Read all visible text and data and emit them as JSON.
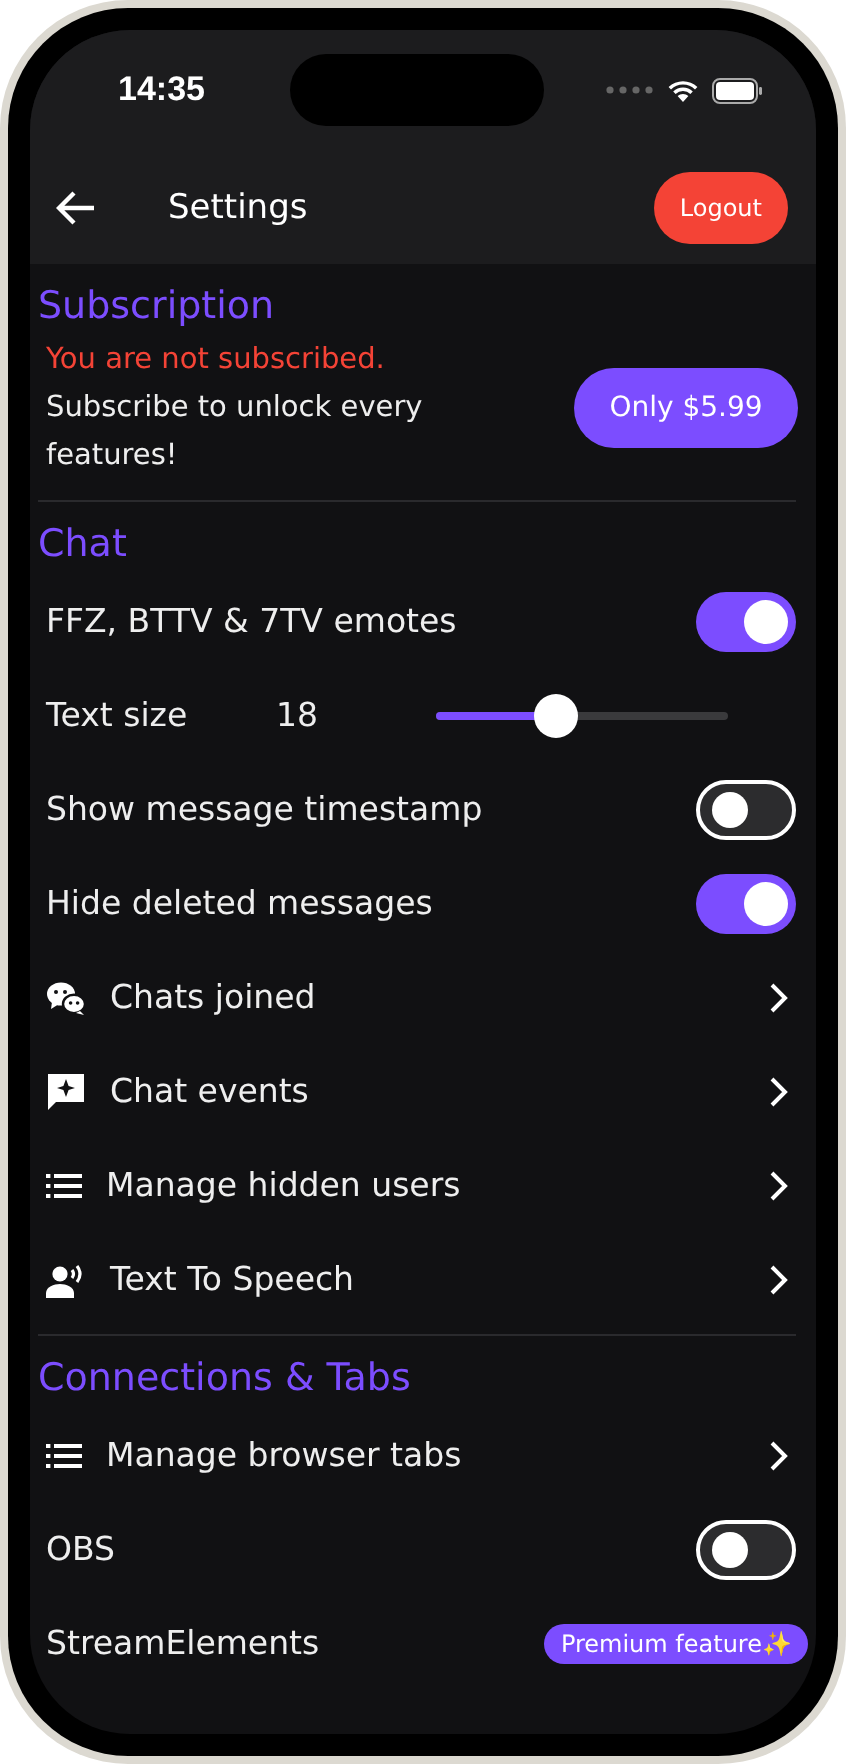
{
  "status_bar": {
    "time": "14:35"
  },
  "app_bar": {
    "title": "Settings",
    "logout": "Logout"
  },
  "sections": [
    {
      "title": "Subscription",
      "warning": "You are not subscribed.",
      "message": "Subscribe to unlock every features!",
      "button": "Only $5.99"
    },
    {
      "title": "Chat",
      "items": [
        {
          "kind": "toggle",
          "label": "FFZ, BTTV & 7TV emotes",
          "on": true
        },
        {
          "kind": "slider",
          "label": "Text size",
          "value": "18",
          "level": 0.36
        },
        {
          "kind": "toggle",
          "label": "Show message timestamp",
          "on": false
        },
        {
          "kind": "toggle",
          "label": "Hide deleted messages",
          "on": true
        },
        {
          "kind": "chats",
          "label": "Chats joined"
        },
        {
          "kind": "events",
          "label": "Chat events"
        },
        {
          "kind": "list",
          "label": "Manage hidden users"
        },
        {
          "kind": "speech",
          "label": "Text To Speech"
        }
      ]
    },
    {
      "title": "Connections & Tabs",
      "items": [
        {
          "kind": "list",
          "label": "Manage browser tabs"
        },
        {
          "kind": "toggle",
          "label": "OBS",
          "on": false
        },
        {
          "kind": "premium",
          "label": "StreamElements",
          "badge": "Premium feature✨"
        }
      ]
    }
  ]
}
